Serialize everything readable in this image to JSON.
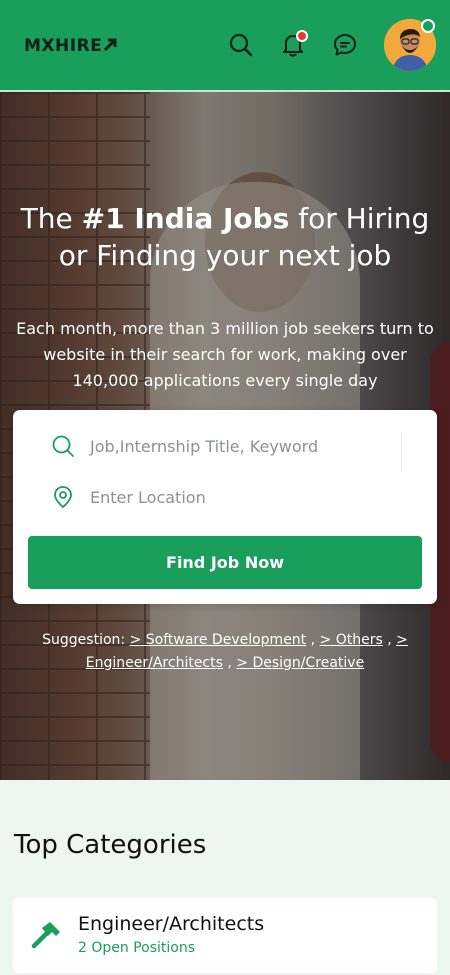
{
  "header": {
    "logo_text": "MXHIRE",
    "accent": "#1a9e5b",
    "icons": [
      "search-icon",
      "bell-icon",
      "chat-icon"
    ]
  },
  "hero": {
    "title_prefix": "The ",
    "title_bold": "#1 India Jobs",
    "title_suffix": " for Hiring or Finding your next job",
    "subtitle": "Each month, more than 3 million job seekers turn to website in their search for work, making over 140,000 applications every single day"
  },
  "search": {
    "keyword_placeholder": "Job,Internship Title, Keyword",
    "location_placeholder": "Enter Location",
    "button_label": "Find Job Now"
  },
  "suggestions": {
    "label": "Suggestion:",
    "items": [
      "> Software Development",
      "> Others",
      ">",
      "Engineer/Architects",
      "> Design/Creative"
    ]
  },
  "categories": {
    "heading": "Top Categories",
    "items": [
      {
        "name": "Engineer/Architects",
        "count": "2 Open Positions"
      }
    ]
  }
}
